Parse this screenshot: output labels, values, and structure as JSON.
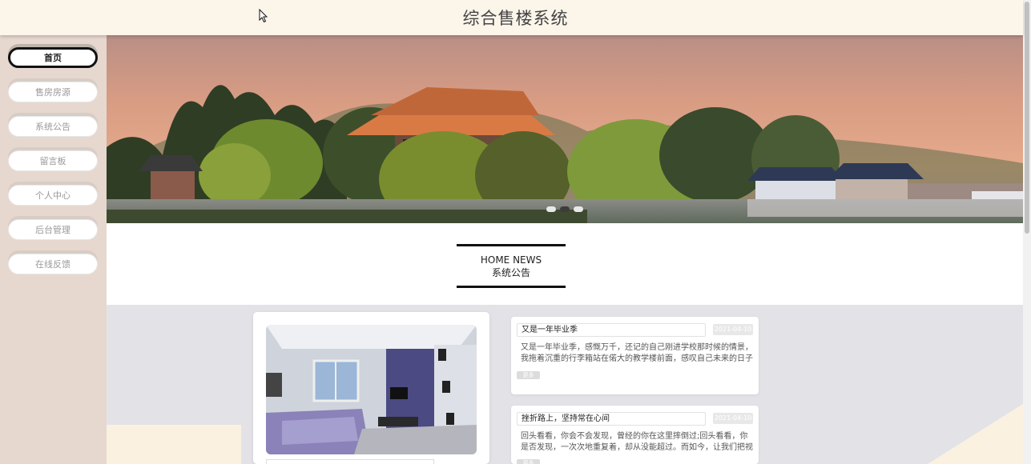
{
  "header": {
    "title": "综合售楼系统"
  },
  "sidebar": {
    "items": [
      {
        "label": "首页",
        "active": true
      },
      {
        "label": "售房房源",
        "active": false
      },
      {
        "label": "系统公告",
        "active": false
      },
      {
        "label": "留言板",
        "active": false
      },
      {
        "label": "个人中心",
        "active": false
      },
      {
        "label": "后台管理",
        "active": false
      },
      {
        "label": "在线反馈",
        "active": false
      }
    ]
  },
  "banner": {
    "slides": 3,
    "active_slide": 2
  },
  "news_section": {
    "title_en": "HOME NEWS",
    "title_cn": "系统公告"
  },
  "news": [
    {
      "title": "又是一年毕业季",
      "date": "2021-04-10",
      "body": "又是一年毕业季，感慨万千，还记的自己刚进学校那时候的情景，我拖着沉重的行李箱站在偌大的教学楼前面，感叹自己未来的日子即...",
      "more": "更多"
    },
    {
      "title": "挫折路上，坚持常在心间",
      "date": "2021-04-10",
      "body": "回头看看，你会不会发现，曾经的你在这里摔倒过;回头看看，你是否发现，一次次地重复着，却从没能超过。而如今，让我们把视线...",
      "more": "更多"
    }
  ],
  "colors": {
    "header_bg": "#fcf5ea",
    "sidebar_bg": "#e6d8cf",
    "news_bg": "#e3e3e7"
  }
}
